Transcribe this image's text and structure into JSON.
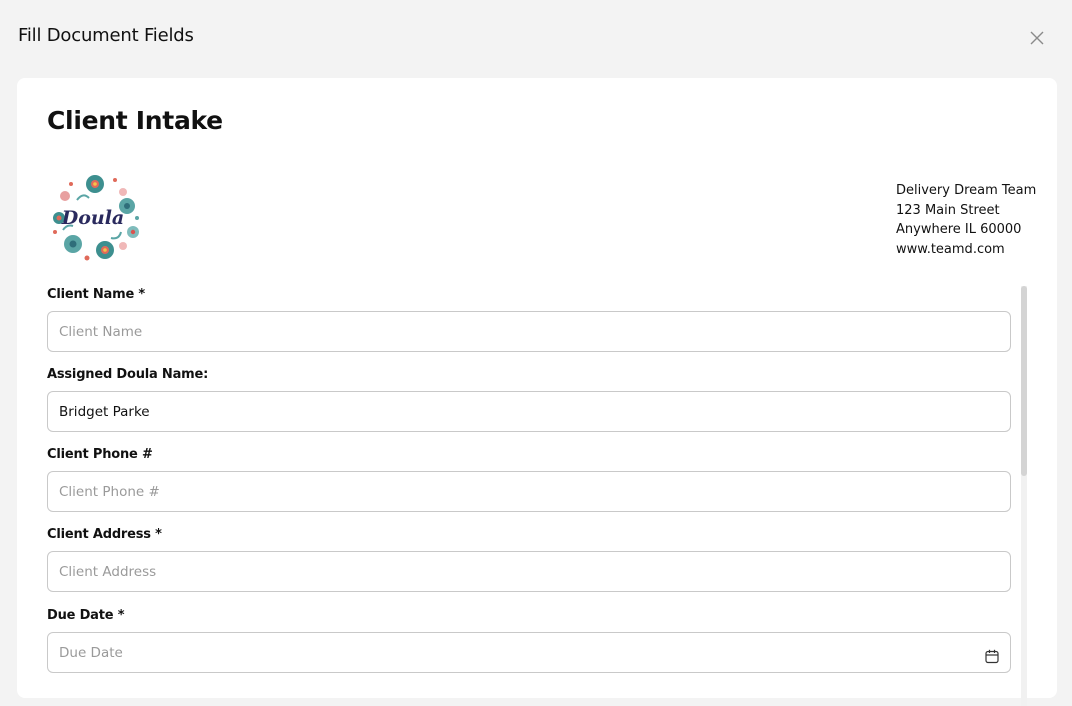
{
  "modal": {
    "title": "Fill Document Fields"
  },
  "document": {
    "title": "Client Intake",
    "logo_text": "Doula",
    "company": {
      "name": "Delivery Dream Team",
      "street": "123 Main Street",
      "city": "Anywhere IL 60000",
      "website": "www.teamd.com"
    }
  },
  "fields": {
    "client_name": {
      "label": "Client Name *",
      "placeholder": "Client Name",
      "value": ""
    },
    "doula_name": {
      "label": "Assigned Doula Name:",
      "placeholder": "",
      "value": "Bridget Parke"
    },
    "client_phone": {
      "label": "Client Phone #",
      "placeholder": "Client Phone #",
      "value": ""
    },
    "client_address": {
      "label": "Client Address *",
      "placeholder": "Client Address",
      "value": ""
    },
    "due_date": {
      "label": "Due Date *",
      "placeholder": "Due Date",
      "value": ""
    }
  },
  "icons": {
    "close": "close-icon",
    "calendar": "calendar-icon"
  },
  "colors": {
    "background": "#f3f3f3",
    "card": "#ffffff",
    "border": "#c9c9c9",
    "placeholder": "#9a9a9a"
  }
}
